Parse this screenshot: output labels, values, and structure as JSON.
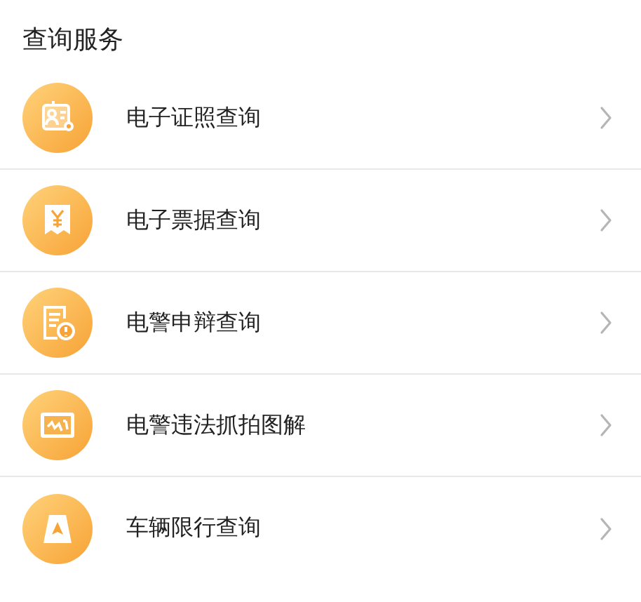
{
  "section_title": "查询服务",
  "items": [
    {
      "label": "电子证照查询"
    },
    {
      "label": "电子票据查询"
    },
    {
      "label": "电警申辩查询"
    },
    {
      "label": "电警违法抓拍图解"
    },
    {
      "label": "车辆限行查询"
    }
  ]
}
